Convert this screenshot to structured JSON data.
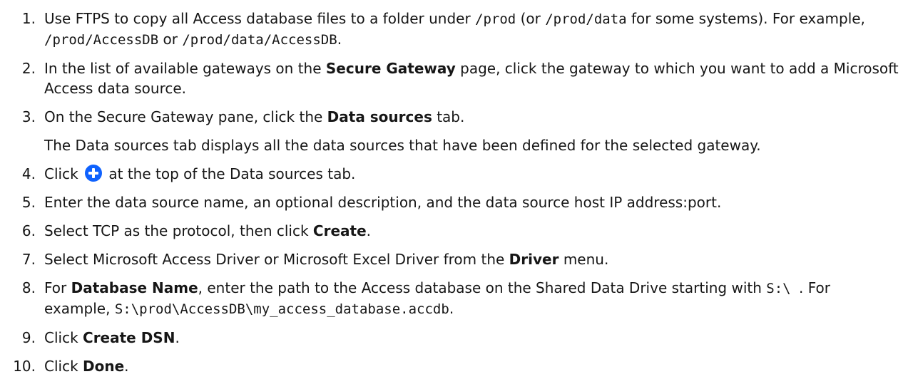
{
  "steps": [
    {
      "num": "1.",
      "t1": "Use FTPS to copy all Access database files to a folder under ",
      "c1": "/prod",
      "t2": " (or ",
      "c2": "/prod/data",
      "t3": " for some systems). For example, ",
      "c3": "/prod/AccessDB",
      "t4": " or ",
      "c4": "/prod/data/AccessDB",
      "t5": "."
    },
    {
      "num": "2.",
      "t1": "In the list of available gateways on the ",
      "b1": "Secure Gateway",
      "t2": " page, click the gateway to which you want to add a Microsoft Access data source."
    },
    {
      "num": "3.",
      "t1": "On the Secure Gateway pane, click the ",
      "b1": "Data sources",
      "t2": " tab.",
      "note": "The Data sources tab displays all the data sources that have been defined for the selected gateway."
    },
    {
      "num": "4.",
      "t1": "Click",
      "t2": " at the top of the Data sources tab.",
      "icon": "add-circle-icon",
      "icon_color": "#0f62fe"
    },
    {
      "num": "5.",
      "t1": "Enter the data source name, an optional description, and the data source host IP address:port."
    },
    {
      "num": "6.",
      "t1": "Select TCP as the protocol, then click ",
      "b1": "Create",
      "t2": "."
    },
    {
      "num": "7.",
      "t1": "Select Microsoft Access Driver or Microsoft Excel Driver from the ",
      "b1": "Driver",
      "t2": " menu."
    },
    {
      "num": "8.",
      "t1": "For ",
      "b1": "Database Name",
      "t2": ", enter the path to the Access database on the Shared Data Drive starting with ",
      "c1": "S:\\ ",
      "t3": ". For example, ",
      "c2": "S:\\prod\\AccessDB\\my_access_database.accdb",
      "t4": "."
    },
    {
      "num": "9.",
      "t1": "Click ",
      "b1": "Create DSN",
      "t2": "."
    },
    {
      "num": "10.",
      "t1": "Click ",
      "b1": "Done",
      "t2": "."
    }
  ]
}
